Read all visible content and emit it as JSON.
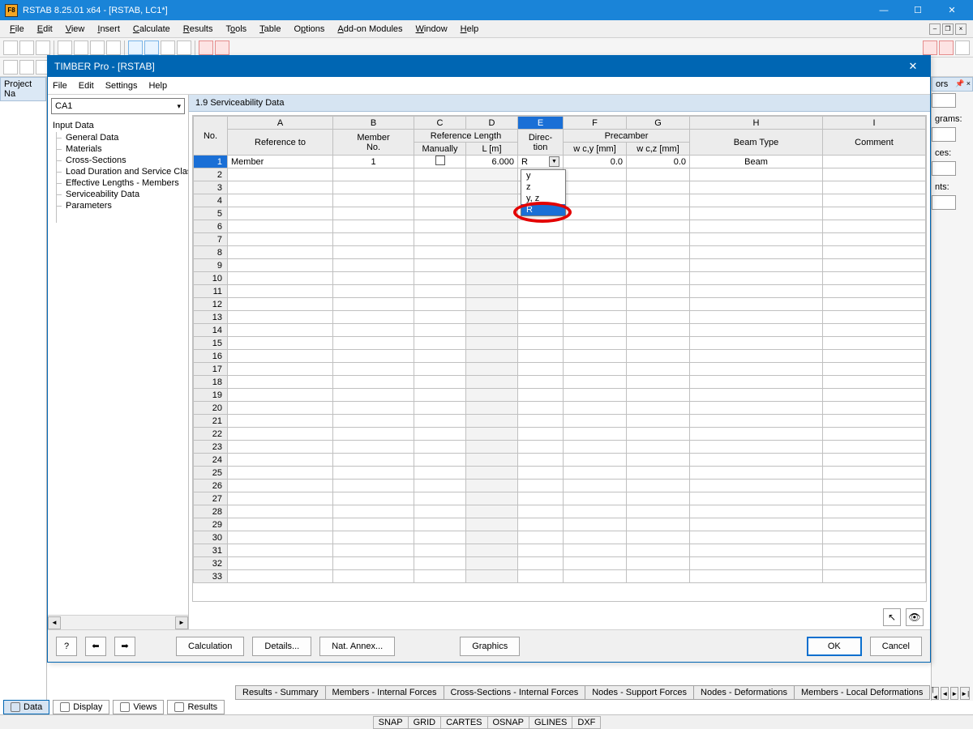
{
  "main_window": {
    "title": "RSTAB 8.25.01 x64 - [RSTAB, LC1*]",
    "app_icon_label": "F8",
    "menu": [
      "File",
      "Edit",
      "View",
      "Insert",
      "Calculate",
      "Results",
      "Tools",
      "Table",
      "Options",
      "Add-on Modules",
      "Window",
      "Help"
    ],
    "project_panel_title": "Project Na"
  },
  "right_panel": {
    "labels": [
      "ors",
      "grams:",
      "ces:",
      "nts:"
    ]
  },
  "dialog": {
    "title": "TIMBER Pro - [RSTAB]",
    "menu": [
      "File",
      "Edit",
      "Settings",
      "Help"
    ],
    "combo_value": "CA1",
    "tree_root": "Input Data",
    "tree_items": [
      "General Data",
      "Materials",
      "Cross-Sections",
      "Load Duration and Service Class",
      "Effective Lengths - Members",
      "Serviceability Data",
      "Parameters"
    ],
    "section_title": "1.9 Serviceability Data",
    "columns_letters": [
      "A",
      "B",
      "C",
      "D",
      "E",
      "F",
      "G",
      "H",
      "I"
    ],
    "columns_group": {
      "ref_len": "Reference Length",
      "precamber": "Precamber"
    },
    "columns_labels": {
      "no": "No.",
      "reference_to": "Reference to",
      "member_no": "Member\nNo.",
      "manually": "Manually",
      "L": "L [m]",
      "direction": "Direc-\ntion",
      "wcy": "w c,y [mm]",
      "wcz": "w c,z [mm]",
      "beam_type": "Beam Type",
      "comment": "Comment"
    },
    "row1": {
      "no": "1",
      "reference_to": "Member",
      "member_no": "1",
      "manually_checked": false,
      "L": "6.000",
      "direction": "R",
      "wcy": "0.0",
      "wcz": "0.0",
      "beam_type": "Beam",
      "comment": ""
    },
    "direction_options": [
      "y",
      "z",
      "y, z",
      "R"
    ],
    "direction_selected": "R",
    "empty_rows": 32,
    "footer": {
      "calculation": "Calculation",
      "details": "Details...",
      "nat_annex": "Nat. Annex...",
      "graphics": "Graphics",
      "ok": "OK",
      "cancel": "Cancel"
    }
  },
  "result_tabs": [
    "Results - Summary",
    "Members - Internal Forces",
    "Cross-Sections - Internal Forces",
    "Nodes - Support Forces",
    "Nodes - Deformations",
    "Members - Local Deformations"
  ],
  "view_tabs": [
    {
      "label": "Data"
    },
    {
      "label": "Display"
    },
    {
      "label": "Views"
    },
    {
      "label": "Results"
    }
  ],
  "statusbar": [
    "SNAP",
    "GRID",
    "CARTES",
    "OSNAP",
    "GLINES",
    "DXF"
  ]
}
